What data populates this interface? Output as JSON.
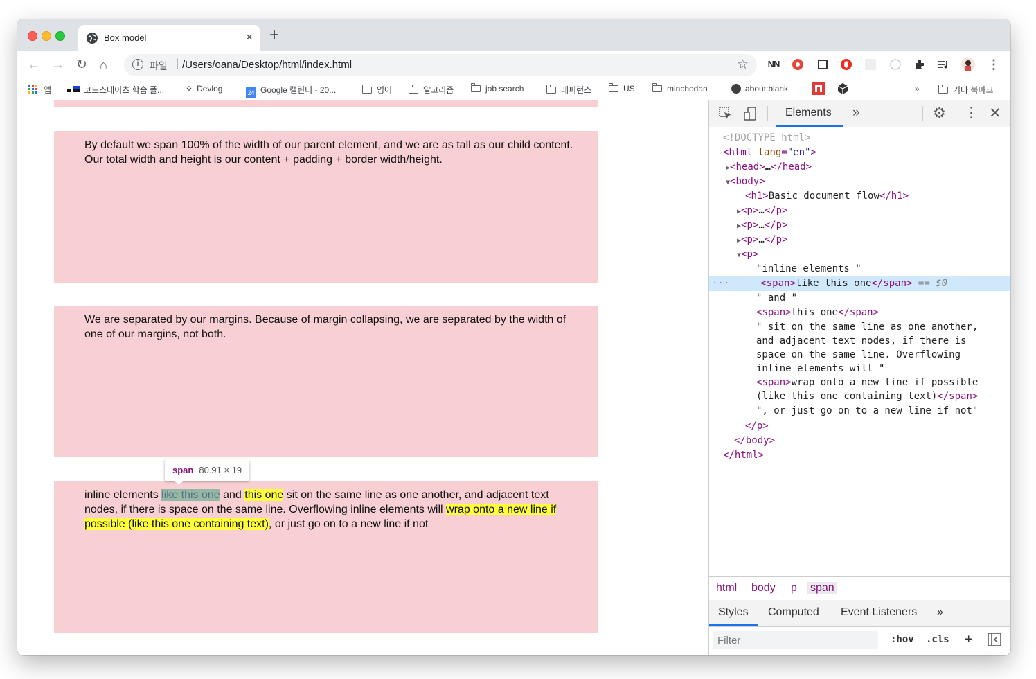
{
  "tab": {
    "title": "Box model",
    "close": "×",
    "new_tab": "+"
  },
  "toolbar": {
    "back": "←",
    "forward": "→",
    "reload": "↻",
    "home": "⌂",
    "scheme_label": "파일",
    "separator": "|",
    "url": "/Users/oana/Desktop/html/index.html",
    "star": "☆",
    "menu": "⋮"
  },
  "bookmarks": {
    "apps": "앱",
    "items": [
      "코드스테이츠 학습 플...",
      "Devlog",
      "Google 캘린더 - 20...",
      "영어",
      "알고리즘",
      "job search",
      "레퍼런스",
      "US",
      "minchodan",
      "about:blank"
    ],
    "overflow": "»",
    "other": "기타 북마크",
    "calendar_badge": "24"
  },
  "page": {
    "box1_text": "By default we span 100% of the width of our parent element, and we are as tall as our child content. Our total width and height is our content + padding + border width/height.",
    "box2_text": "We are separated by our margins. Because of margin collapsing, we are separated by the width of one of our margins, not both.",
    "box3": {
      "t1": "inline elements ",
      "s1": "like this one",
      "t2": " and ",
      "s2": "this one",
      "t3": " sit on the same line as one another, and adjacent text nodes, if there is space on the same line. Overflowing inline elements will ",
      "s3": "wrap onto a new line if possible (like this one containing text)",
      "t4": ", or just go on to a new line if not"
    },
    "tooltip": {
      "tag": "span",
      "dims": "80.91 × 19"
    }
  },
  "devtools": {
    "panel_tab": "Elements",
    "more_tabs": "»",
    "gear": "⚙",
    "kebab": "⋮",
    "close": "✕",
    "tree": {
      "doctype": "<!DOCTYPE html>",
      "html_open_tag": "html",
      "html_attr": "lang",
      "html_attr_val": "\"en\"",
      "head": "head",
      "ellipsis": "…",
      "body": "body",
      "h1_tag": "h1",
      "h1_text": "Basic document flow",
      "p_tag": "p",
      "text1": "\"inline elements \"",
      "span_tag": "span",
      "span1_text": "like this one",
      "selected_marker": "== $0",
      "dots": "···",
      "text2": "\" and \"",
      "span2_text": "this one",
      "text3_lines": [
        "\" sit on the same line as one another,",
        "and adjacent text nodes, if there is",
        "space on the same line. Overflowing",
        "inline elements will \""
      ],
      "span3_lines": [
        "wrap onto a new line if possible",
        "(like this one containing text)"
      ],
      "text4": "\", or just go on to a new line if not\""
    },
    "breadcrumbs": [
      "html",
      "body",
      "p",
      "span"
    ],
    "style_tabs": [
      "Styles",
      "Computed",
      "Event Listeners",
      "»"
    ],
    "filter_placeholder": "Filter",
    "hov": ":hov",
    "cls": ".cls",
    "plus": "+"
  },
  "colors": {
    "box_bg": "#f8cfd3",
    "highlight_yellow": "#ffff3b",
    "highlight_green": "#93b8a3",
    "devtools_selection": "#cfe8fc",
    "accent_blue": "#1a73e8"
  }
}
